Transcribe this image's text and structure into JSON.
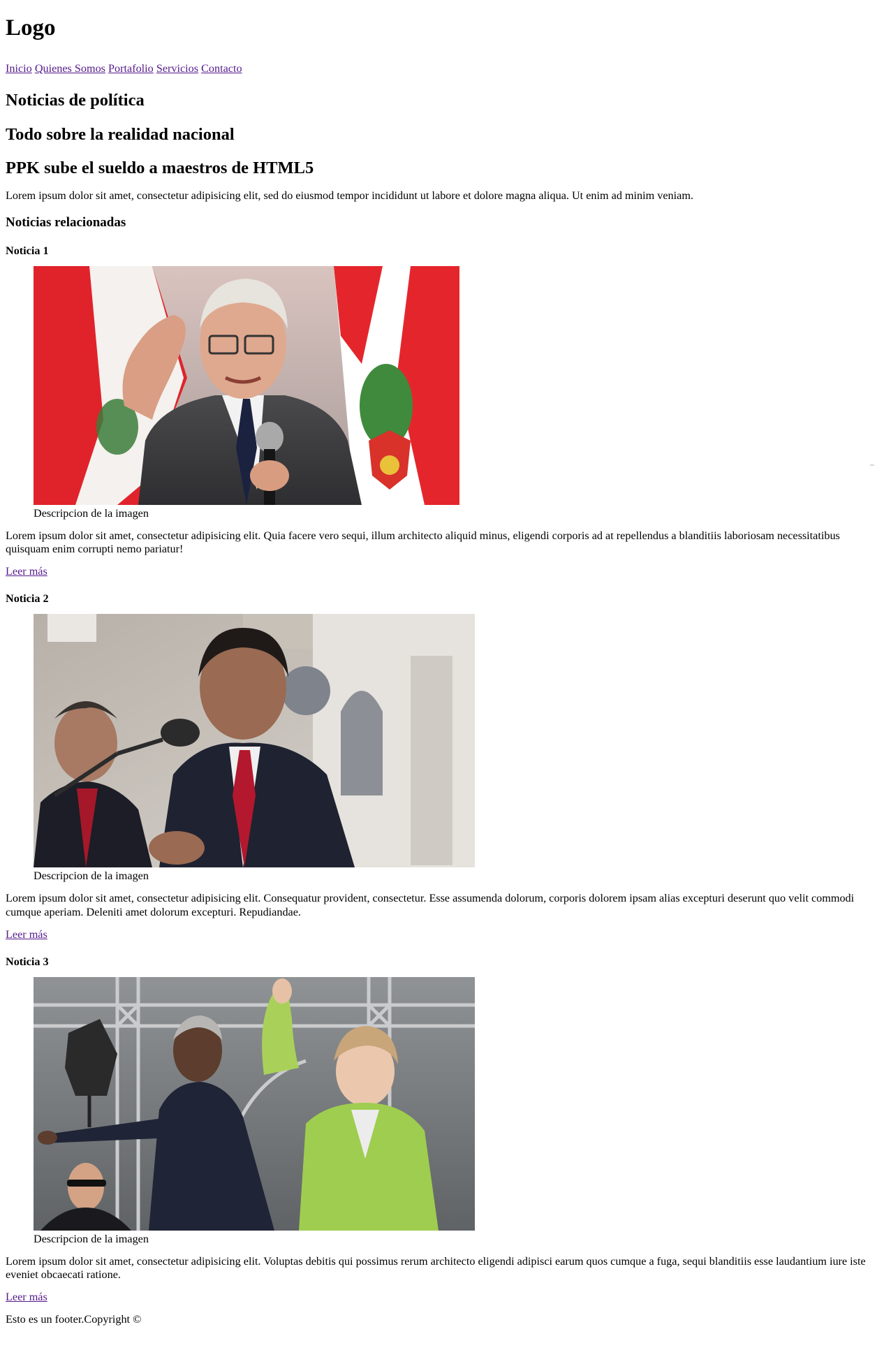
{
  "header": {
    "logo": "Logo",
    "nav": [
      {
        "label": "Inicio"
      },
      {
        "label": "Quienes Somos"
      },
      {
        "label": "Portafolio"
      },
      {
        "label": "Servicios"
      },
      {
        "label": "Contacto"
      }
    ]
  },
  "main": {
    "section_title": "Noticias de política",
    "section_subtitle": "Todo sobre la realidad nacional",
    "article_title": "PPK sube el sueldo a maestros de HTML5",
    "article_lead": "Lorem ipsum dolor sit amet, consectetur adipisicing elit, sed do eiusmod tempor incididunt ut labore et dolore magna aliqua. Ut enim ad minim veniam.",
    "related_title": "Noticias relacionadas",
    "news": [
      {
        "title": "Noticia 1",
        "caption": "Descripcion de la imagen",
        "text": "Lorem ipsum dolor sit amet, consectetur adipisicing elit. Quia facere vero sequi, illum architecto aliquid minus, eligendi corporis ad at repellendus a blanditiis laboriosam necessitatibus quisquam enim corrupti nemo pariatur!",
        "link": "Leer más"
      },
      {
        "title": "Noticia 2",
        "caption": "Descripcion de la imagen",
        "text": "Lorem ipsum dolor sit amet, consectetur adipisicing elit. Consequatur provident, consectetur. Esse assumenda dolorum, corporis dolorem ipsam alias excepturi deserunt quo velit commodi cumque aperiam. Deleniti amet dolorum excepturi. Repudiandae.",
        "link": "Leer más"
      },
      {
        "title": "Noticia 3",
        "caption": "Descripcion de la imagen",
        "text": "Lorem ipsum dolor sit amet, consectetur adipisicing elit. Voluptas debitis qui possimus rerum architecto eligendi adipisci earum quos cumque a fuga, sequi blanditiis esse laudantium iure iste eveniet obcaecati ratione.",
        "link": "Leer más"
      }
    ]
  },
  "footer": {
    "text": "Esto es un footer.Copyright ©"
  }
}
